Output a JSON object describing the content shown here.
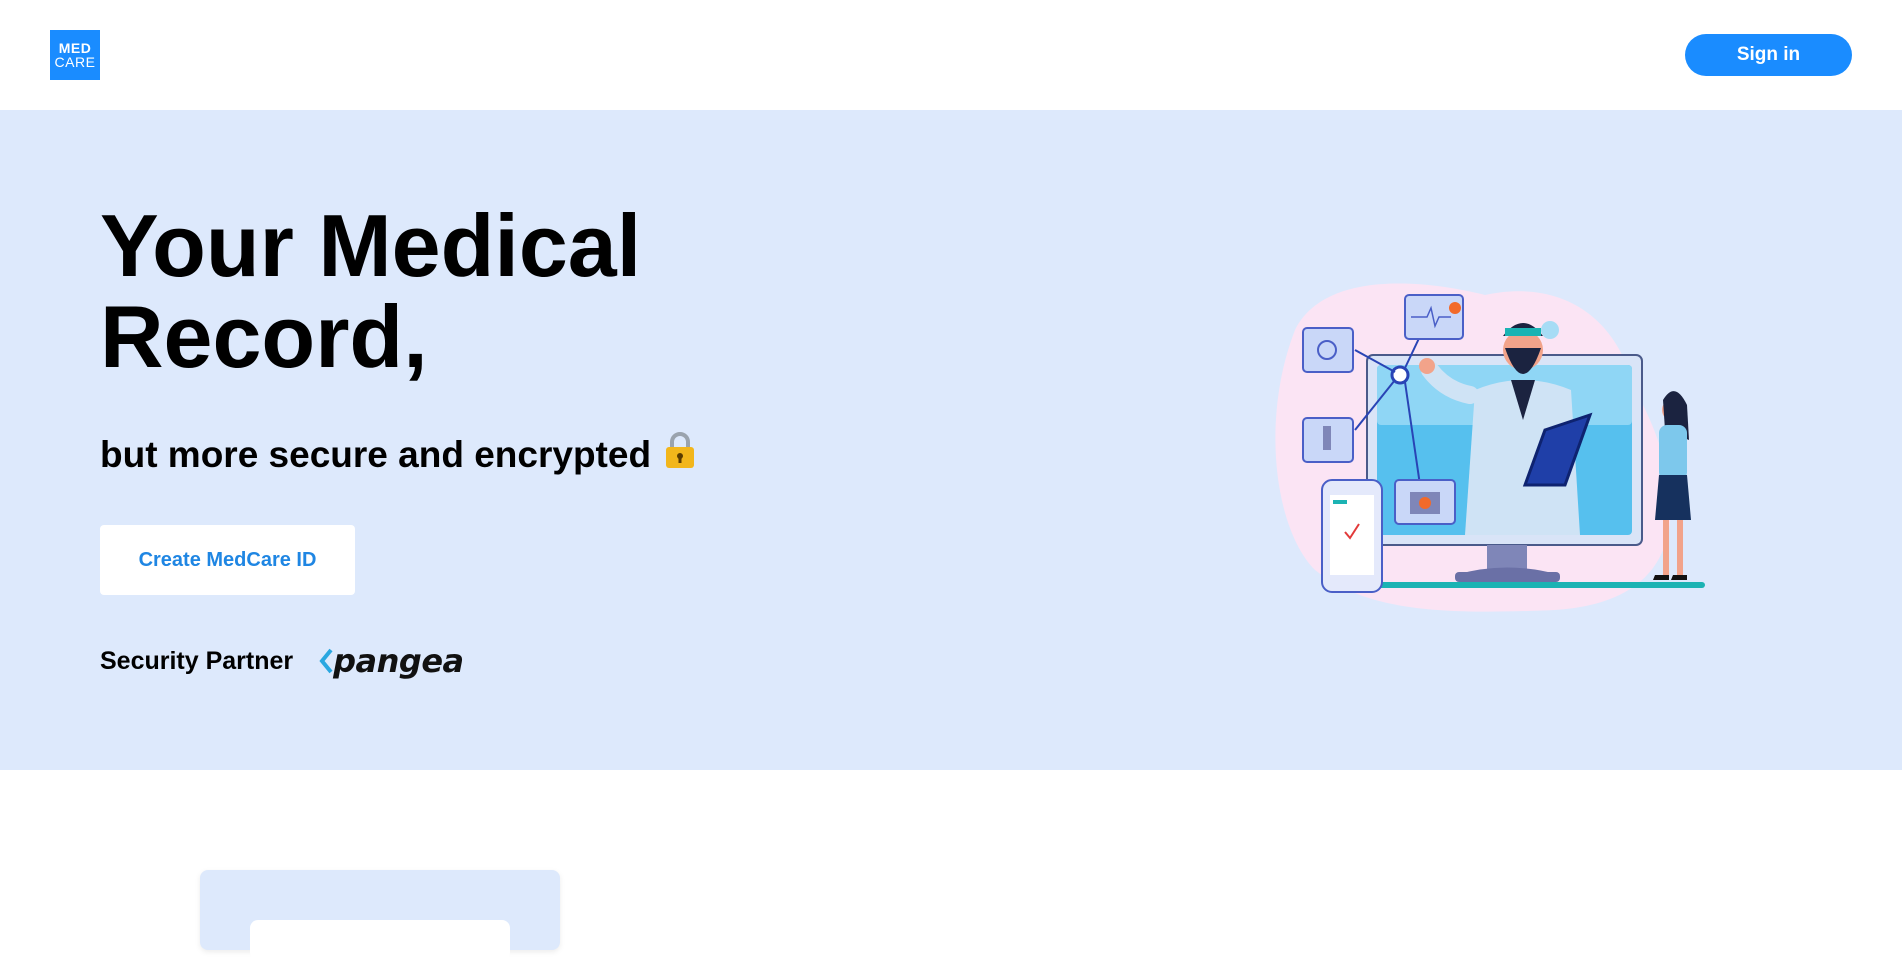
{
  "header": {
    "logo_line1": "MED",
    "logo_line2": "CARE",
    "signin_label": "Sign in"
  },
  "hero": {
    "headline": "Your Medical Record,",
    "subline": "but more secure and encrypted",
    "lock_glyph": "🔒",
    "create_button_label": "Create MedCare ID",
    "partner_label": "Security Partner",
    "partner_name": "pangea"
  },
  "colors": {
    "brand_blue": "#1a8cff",
    "hero_bg": "#dde9fc",
    "button_text": "#1f86e3"
  }
}
